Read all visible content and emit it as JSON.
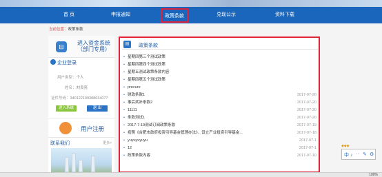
{
  "nav": {
    "items": [
      "首 页",
      "申报通知",
      "政策条款",
      "兑现公示",
      "资料下载"
    ]
  },
  "breadcrumb": {
    "prefix": "当前位置：",
    "current": "政策条款"
  },
  "sidebar": {
    "system_title_line1": "进入资金系统",
    "system_title_line2": "（部门专用）",
    "login_header": "企业登录",
    "user_type_label": "用户类型：",
    "user_type_value": "个人",
    "name_label": "姓名：",
    "name_value": "刘良亮",
    "id_label": "证件号码：",
    "id_value": "340122199308034077",
    "enter_button": "进入系统",
    "exit_button": "退 出",
    "register": "用户注册",
    "contact": "联系我们",
    "more": "更多>"
  },
  "panel": {
    "title": "政策条款",
    "items": [
      {
        "title": "星期四第三个测试政策",
        "date": ""
      },
      {
        "title": "星期四第四个测试政策",
        "date": ""
      },
      {
        "title": "星期五测试政策条款内容",
        "date": ""
      },
      {
        "title": "星期四第五个测试政策",
        "date": ""
      },
      {
        "title": "precure",
        "date": ""
      },
      {
        "title": "财政条款1",
        "date": "2017-07-20"
      },
      {
        "title": "事后奖补条款2",
        "date": "2017-07-20"
      },
      {
        "title": "11111",
        "date": "2017-07-20"
      },
      {
        "title": "条款测试1",
        "date": "2017-07-20"
      },
      {
        "title": "2017-7-19测试订阅政策条款",
        "date": "2017-07-19"
      },
      {
        "title": "按照《合肥市政府投资引导基金管理办法》，设立产业投资引导基金...",
        "date": "2017-07-18"
      },
      {
        "title": "yuyuyuyuyu",
        "date": "2017-07-1"
      },
      {
        "title": "12",
        "date": "2017-07-1"
      },
      {
        "title": "政策条款内容",
        "date": "2017-07-10"
      }
    ]
  },
  "toolbar_label": "中 ♪",
  "status": {
    "zoom": "100%"
  }
}
